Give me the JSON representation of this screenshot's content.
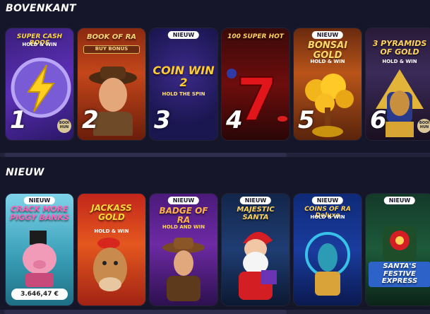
{
  "sections": [
    {
      "title": "BOVENKANT",
      "games": [
        {
          "rank": "1",
          "title": "SUPER CASH BOOS",
          "subtitle": "HOLD & WIN",
          "brand": "BOOI HUN",
          "badge": ""
        },
        {
          "rank": "2",
          "title": "BOOK OF RA",
          "subtitle": "BUY BONUS",
          "badge": ""
        },
        {
          "rank": "3",
          "title": "COIN WIN 2",
          "subtitle": "HOLD THE SPIN",
          "badge": "NIEUW"
        },
        {
          "rank": "4",
          "title": "100 SUPER HOT",
          "subtitle": "",
          "badge": ""
        },
        {
          "rank": "5",
          "title": "BONSAI GOLD",
          "subtitle": "HOLD & WIN",
          "badge": "NIEUW"
        },
        {
          "rank": "6",
          "title": "3 PYRAMIDS OF GOLD",
          "subtitle": "HOLD & WIN",
          "brand": "BOOI HUN",
          "badge": ""
        }
      ]
    },
    {
      "title": "NIEUW",
      "games": [
        {
          "title": "CRACK MORE PIGGY BANKS",
          "badge": "NIEUW",
          "jackpot": "3.646,47 €"
        },
        {
          "title": "JACKASS GOLD",
          "subtitle": "HOLD & WIN",
          "badge": ""
        },
        {
          "title": "BADGE OF RA",
          "subtitle": "HOLD AND WIN",
          "badge": "NIEUW"
        },
        {
          "title": "MAJESTIC SANTA",
          "badge": "NIEUW"
        },
        {
          "title": "COINS OF RA Deluxe",
          "subtitle": "HOLD & WIN",
          "badge": "NIEUW"
        },
        {
          "title": "SANTA'S FESTIVE EXPRESS",
          "badge": "NIEUW"
        }
      ]
    }
  ],
  "colors": {
    "background": "#16162a",
    "badge_bg": "#ffffff"
  }
}
